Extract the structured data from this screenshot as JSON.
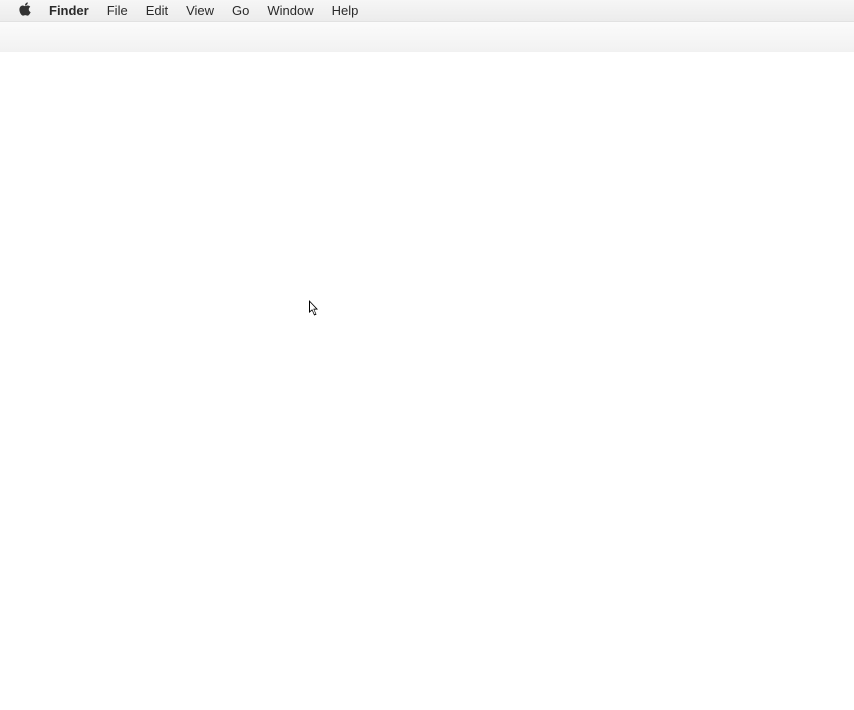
{
  "menubar": {
    "app_name": "Finder",
    "items": [
      {
        "label": "File"
      },
      {
        "label": "Edit"
      },
      {
        "label": "View"
      },
      {
        "label": "Go"
      },
      {
        "label": "Window"
      },
      {
        "label": "Help"
      }
    ]
  }
}
